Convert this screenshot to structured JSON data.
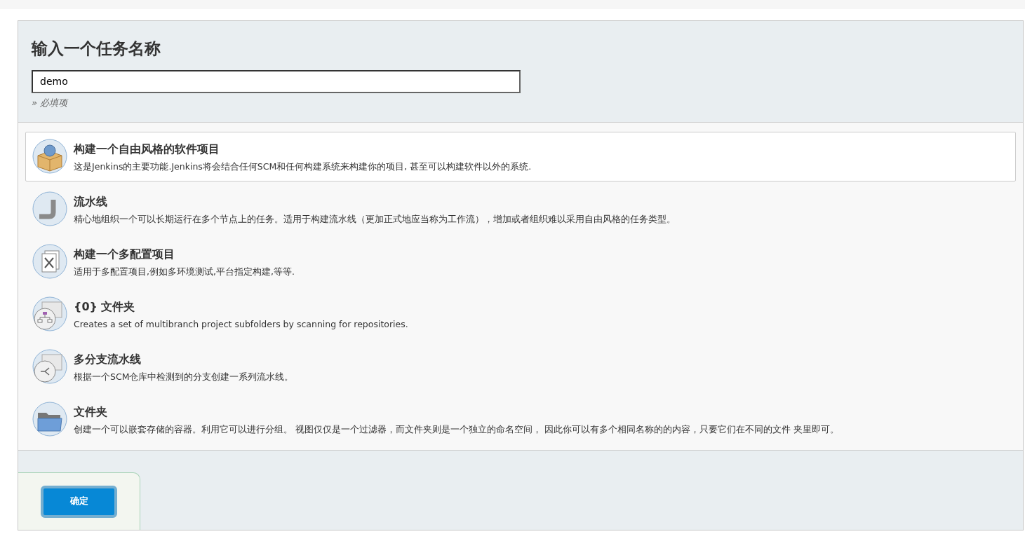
{
  "header": {
    "title": "输入一个任务名称",
    "name_field": {
      "value": "demo"
    },
    "required_note": "» 必填项"
  },
  "items": [
    {
      "kind": "freestyle",
      "title": "构建一个自由风格的软件项目",
      "description": "这是Jenkins的主要功能.Jenkins将会结合任何SCM和任何构建系统来构建你的项目, 甚至可以构建软件以外的系统.",
      "selected": true
    },
    {
      "kind": "pipeline",
      "title": "流水线",
      "description": "精心地组织一个可以长期运行在多个节点上的任务。适用于构建流水线（更加正式地应当称为工作流），增加或者组织难以采用自由风格的任务类型。",
      "selected": false
    },
    {
      "kind": "multiconfig",
      "title": "构建一个多配置项目",
      "description": "适用于多配置项目,例如多环境测试,平台指定构建,等等.",
      "selected": false
    },
    {
      "kind": "orgfolder",
      "title": "{0} 文件夹",
      "description": "Creates a set of multibranch project subfolders by scanning for repositories.",
      "selected": false
    },
    {
      "kind": "multibranch",
      "title": "多分支流水线",
      "description": "根据一个SCM仓库中检测到的分支创建一系列流水线。",
      "selected": false
    },
    {
      "kind": "folder",
      "title": "文件夹",
      "description": "创建一个可以嵌套存储的容器。利用它可以进行分组。 视图仅仅是一个过滤器，而文件夹则是一个独立的命名空间， 因此你可以有多个相同名称的的内容，只要它们在不同的文件 夹里即可。",
      "selected": false
    }
  ],
  "ok_button": "确定"
}
